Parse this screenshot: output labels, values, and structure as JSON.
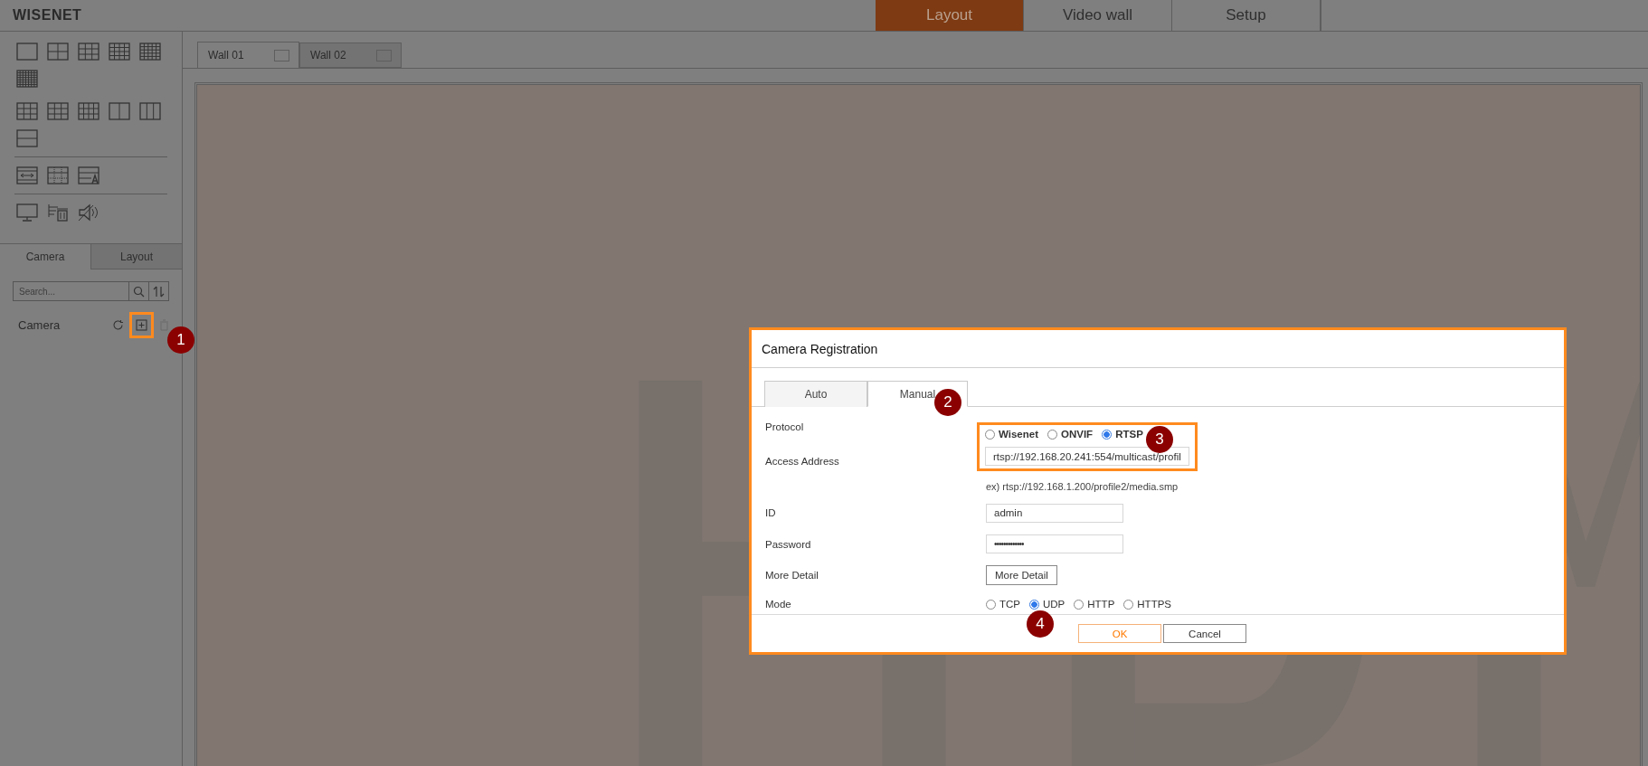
{
  "app": {
    "logo": "WISENET"
  },
  "nav_tabs": [
    {
      "label": "Layout",
      "selected": true
    },
    {
      "label": "Video wall",
      "selected": false
    },
    {
      "label": "Setup",
      "selected": false
    }
  ],
  "wall_tabs": [
    {
      "label": "Wall 01",
      "selected": true
    },
    {
      "label": "Wall 02",
      "selected": false
    }
  ],
  "sidebar": {
    "tabs": [
      {
        "label": "Camera",
        "selected": true
      },
      {
        "label": "Layout",
        "selected": false
      }
    ],
    "search": {
      "placeholder": "Search..."
    },
    "tree_root": "Camera"
  },
  "dialog": {
    "title": "Camera Registration",
    "tabs": [
      {
        "label": "Auto",
        "selected": false
      },
      {
        "label": "Manual",
        "selected": true
      }
    ],
    "protocol": {
      "label": "Protocol",
      "options": [
        {
          "label": "Wisenet",
          "selected": false
        },
        {
          "label": "ONVIF",
          "selected": false
        },
        {
          "label": "RTSP",
          "selected": true
        }
      ]
    },
    "access_address": {
      "label": "Access Address",
      "value": "rtsp://192.168.20.241:554/multicast/profil",
      "example": "ex) rtsp://192.168.1.200/profile2/media.smp"
    },
    "id": {
      "label": "ID",
      "value": "admin"
    },
    "password": {
      "label": "Password",
      "value": "•••••••••••••"
    },
    "more_detail": {
      "label": "More Detail",
      "button": "More Detail"
    },
    "mode": {
      "label": "Mode",
      "options": [
        {
          "label": "TCP",
          "selected": false
        },
        {
          "label": "UDP",
          "selected": true
        },
        {
          "label": "HTTP",
          "selected": false
        },
        {
          "label": "HTTPS",
          "selected": false
        }
      ]
    },
    "buttons": [
      {
        "label": "OK",
        "kind": "primary"
      },
      {
        "label": "Cancel",
        "kind": "secondary"
      }
    ]
  },
  "callouts": [
    "1",
    "2",
    "3",
    "4"
  ]
}
